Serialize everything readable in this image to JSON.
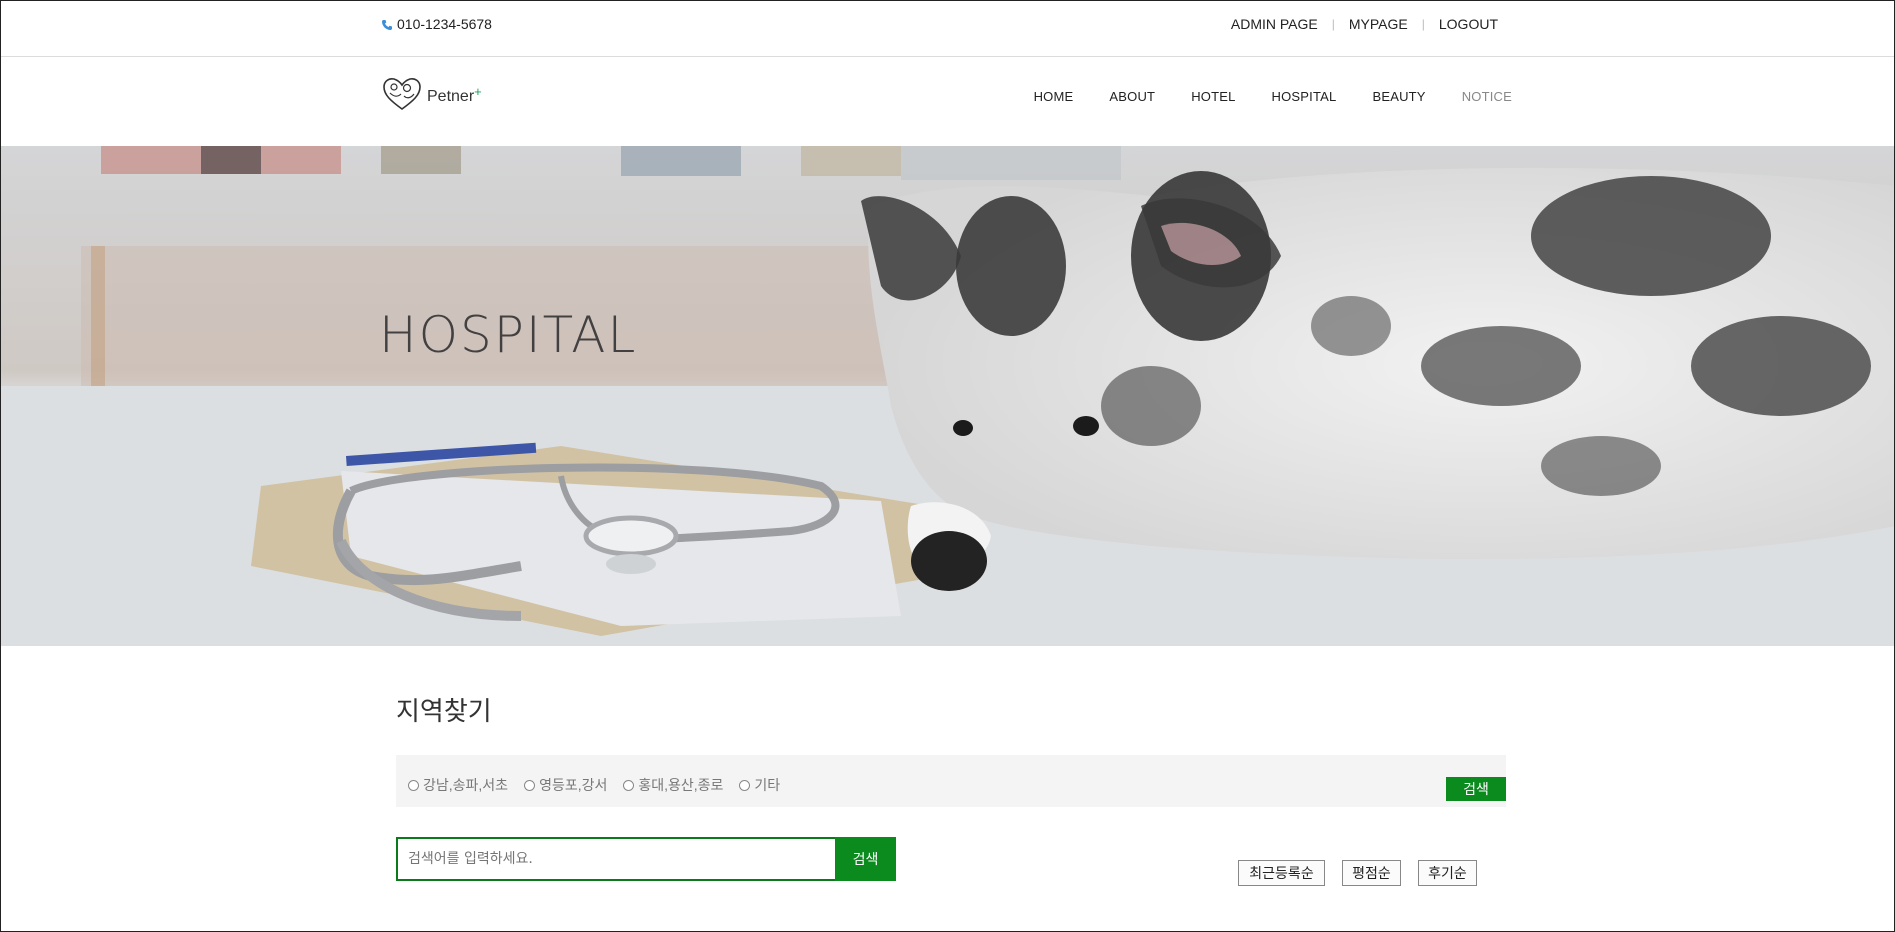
{
  "topbar": {
    "phone": "010-1234-5678",
    "links": [
      "ADMIN PAGE",
      "MYPAGE",
      "LOGOUT"
    ]
  },
  "header": {
    "logo_text": "Petner",
    "logo_plus": "+",
    "nav": [
      "HOME",
      "ABOUT",
      "HOTEL",
      "HOSPITAL",
      "BEAUTY",
      "NOTICE"
    ]
  },
  "hero": {
    "title": "HOSPITAL"
  },
  "region": {
    "title": "지역찾기",
    "options": [
      "강남,송파,서초",
      "영등포,강서",
      "홍대,용산,종로",
      "기타"
    ],
    "search_label": "검색"
  },
  "search": {
    "placeholder": "검색어를 입력하세요.",
    "button_label": "검색"
  },
  "sort": {
    "options": [
      "최근등록순",
      "평점순",
      "후기순"
    ]
  },
  "colors": {
    "accent": "#0b8a1e",
    "phone_icon": "#3a8fd8"
  }
}
